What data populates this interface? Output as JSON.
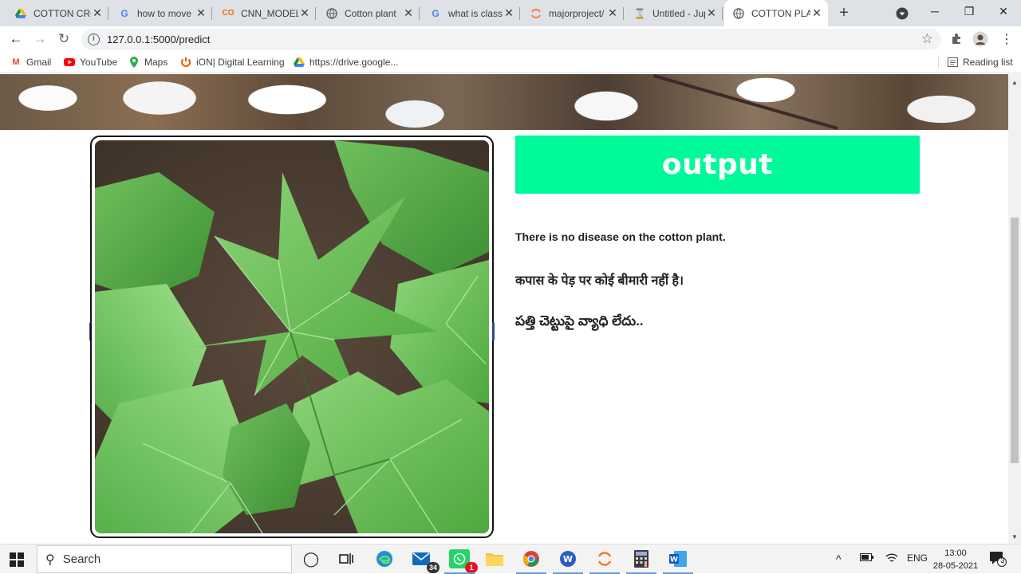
{
  "browser": {
    "tabs": [
      {
        "title": "COTTON CRO",
        "icon": "google-drive-icon"
      },
      {
        "title": "how to move",
        "icon": "google-icon"
      },
      {
        "title": "CNN_MODEL",
        "icon": "colab-icon"
      },
      {
        "title": "Cotton plant",
        "icon": "globe-icon"
      },
      {
        "title": "what is classif",
        "icon": "google-icon"
      },
      {
        "title": "majorproject/",
        "icon": "jupyter-icon"
      },
      {
        "title": "Untitled - Jup",
        "icon": "hourglass-icon"
      },
      {
        "title": "COTTON PLA",
        "icon": "globe-icon",
        "active": true
      }
    ],
    "url": "127.0.0.1:5000/predict",
    "bookmarks": [
      {
        "label": "Gmail",
        "icon": "gmail-icon"
      },
      {
        "label": "YouTube",
        "icon": "youtube-icon"
      },
      {
        "label": "Maps",
        "icon": "maps-icon"
      },
      {
        "label": "iON| Digital Learning",
        "icon": "ion-icon"
      },
      {
        "label": "https://drive.google...",
        "icon": "google-drive-icon"
      }
    ],
    "reading_list": "Reading list"
  },
  "page": {
    "output_heading": "output",
    "result_english": "There is no disease on the cotton plant.",
    "result_hindi": "कपास के पेड़ पर कोई बीमारी नहीं है।",
    "result_telugu": "పత్తి చెట్టుపై వ్యాధి లేదు.."
  },
  "taskbar": {
    "search_label": "Search",
    "mail_badge": "34",
    "whatsapp_badge": "1",
    "language": "ENG",
    "time": "13:00",
    "date": "28-05-2021",
    "notification_count": "3"
  },
  "colors": {
    "output_bg": "#00fa9a",
    "tab_strip": "#dee1e6"
  }
}
